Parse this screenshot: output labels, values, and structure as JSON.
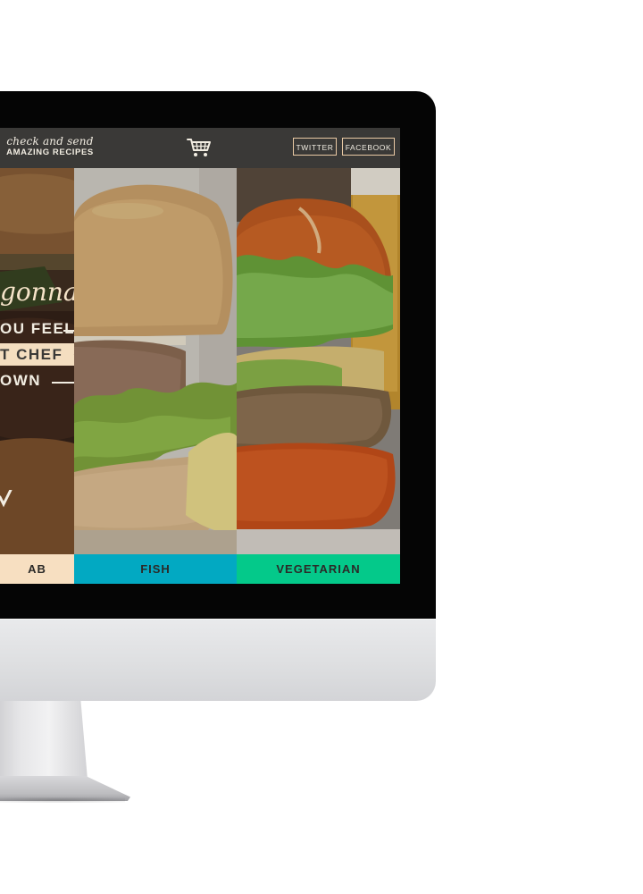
{
  "site": {
    "brand": {
      "script": "check and send",
      "caps": "AMAZING RECIPES"
    },
    "nav": {
      "cart_icon": "shopping-cart-icon",
      "twitter_label": "TWITTER",
      "facebook_label": "FACEBOOK"
    },
    "hero": {
      "script": "gonna",
      "line1": "OU FEEL",
      "line2": "T CHEF",
      "line3": "OWN"
    },
    "categories": [
      {
        "label": "AB",
        "color": "#f7dfc1"
      },
      {
        "label": "FISH",
        "color": "#02a9c2"
      },
      {
        "label": "VEGETARIAN",
        "color": "#04c98a"
      }
    ]
  },
  "colors": {
    "nav_bg": "#3a3937",
    "accent_border": "#e9c9a4",
    "text_light": "#f2ede2"
  }
}
